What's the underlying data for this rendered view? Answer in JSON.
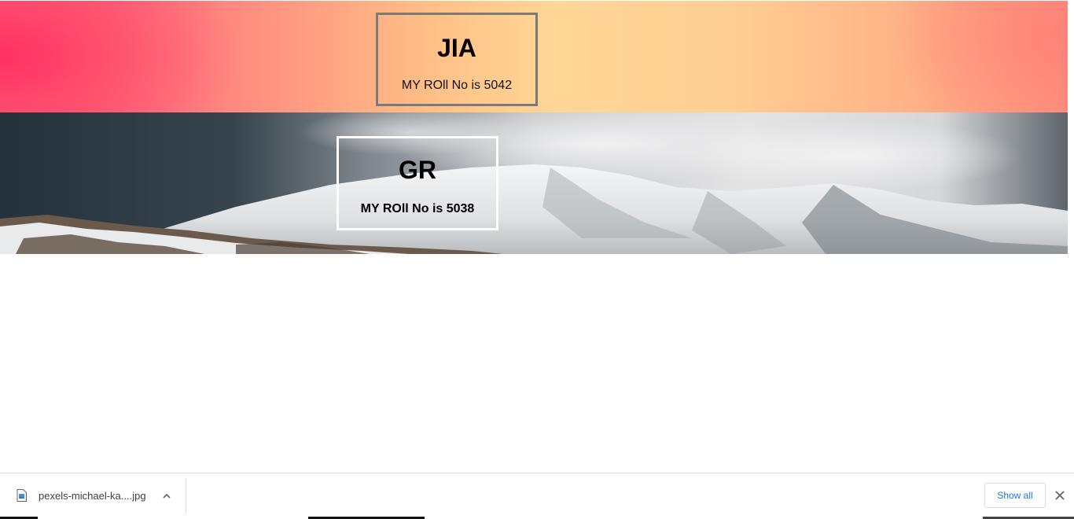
{
  "cards": [
    {
      "name": "JIA",
      "roll_text": "MY ROll No is 5042"
    },
    {
      "name": "GR",
      "roll_text": "MY ROll No is 5038"
    }
  ],
  "banners": {
    "top_gradient_colors": [
      "#ff4f78",
      "#ffd696",
      "#ff8f7d"
    ],
    "mountain_image": "snowy-mountain-photo"
  },
  "download_bar": {
    "item": {
      "file_name": "pexels-michael-ka....jpg",
      "icon": "image-file-icon"
    },
    "show_all_label": "Show all",
    "accent_color": "#1a73e8"
  }
}
